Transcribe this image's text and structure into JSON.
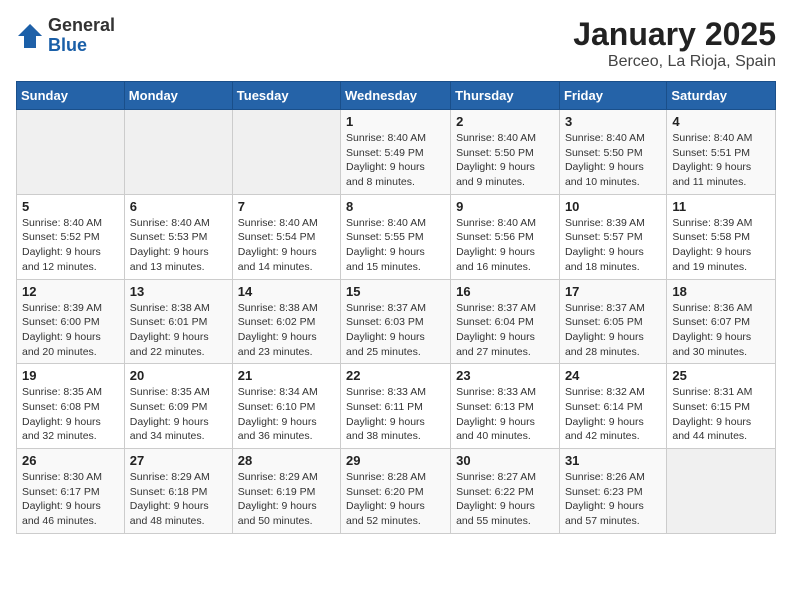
{
  "header": {
    "logo_general": "General",
    "logo_blue": "Blue",
    "month_title": "January 2025",
    "location": "Berceo, La Rioja, Spain"
  },
  "weekdays": [
    "Sunday",
    "Monday",
    "Tuesday",
    "Wednesday",
    "Thursday",
    "Friday",
    "Saturday"
  ],
  "weeks": [
    [
      {
        "day": "",
        "info": ""
      },
      {
        "day": "",
        "info": ""
      },
      {
        "day": "",
        "info": ""
      },
      {
        "day": "1",
        "info": "Sunrise: 8:40 AM\nSunset: 5:49 PM\nDaylight: 9 hours and 8 minutes."
      },
      {
        "day": "2",
        "info": "Sunrise: 8:40 AM\nSunset: 5:50 PM\nDaylight: 9 hours and 9 minutes."
      },
      {
        "day": "3",
        "info": "Sunrise: 8:40 AM\nSunset: 5:50 PM\nDaylight: 9 hours and 10 minutes."
      },
      {
        "day": "4",
        "info": "Sunrise: 8:40 AM\nSunset: 5:51 PM\nDaylight: 9 hours and 11 minutes."
      }
    ],
    [
      {
        "day": "5",
        "info": "Sunrise: 8:40 AM\nSunset: 5:52 PM\nDaylight: 9 hours and 12 minutes."
      },
      {
        "day": "6",
        "info": "Sunrise: 8:40 AM\nSunset: 5:53 PM\nDaylight: 9 hours and 13 minutes."
      },
      {
        "day": "7",
        "info": "Sunrise: 8:40 AM\nSunset: 5:54 PM\nDaylight: 9 hours and 14 minutes."
      },
      {
        "day": "8",
        "info": "Sunrise: 8:40 AM\nSunset: 5:55 PM\nDaylight: 9 hours and 15 minutes."
      },
      {
        "day": "9",
        "info": "Sunrise: 8:40 AM\nSunset: 5:56 PM\nDaylight: 9 hours and 16 minutes."
      },
      {
        "day": "10",
        "info": "Sunrise: 8:39 AM\nSunset: 5:57 PM\nDaylight: 9 hours and 18 minutes."
      },
      {
        "day": "11",
        "info": "Sunrise: 8:39 AM\nSunset: 5:58 PM\nDaylight: 9 hours and 19 minutes."
      }
    ],
    [
      {
        "day": "12",
        "info": "Sunrise: 8:39 AM\nSunset: 6:00 PM\nDaylight: 9 hours and 20 minutes."
      },
      {
        "day": "13",
        "info": "Sunrise: 8:38 AM\nSunset: 6:01 PM\nDaylight: 9 hours and 22 minutes."
      },
      {
        "day": "14",
        "info": "Sunrise: 8:38 AM\nSunset: 6:02 PM\nDaylight: 9 hours and 23 minutes."
      },
      {
        "day": "15",
        "info": "Sunrise: 8:37 AM\nSunset: 6:03 PM\nDaylight: 9 hours and 25 minutes."
      },
      {
        "day": "16",
        "info": "Sunrise: 8:37 AM\nSunset: 6:04 PM\nDaylight: 9 hours and 27 minutes."
      },
      {
        "day": "17",
        "info": "Sunrise: 8:37 AM\nSunset: 6:05 PM\nDaylight: 9 hours and 28 minutes."
      },
      {
        "day": "18",
        "info": "Sunrise: 8:36 AM\nSunset: 6:07 PM\nDaylight: 9 hours and 30 minutes."
      }
    ],
    [
      {
        "day": "19",
        "info": "Sunrise: 8:35 AM\nSunset: 6:08 PM\nDaylight: 9 hours and 32 minutes."
      },
      {
        "day": "20",
        "info": "Sunrise: 8:35 AM\nSunset: 6:09 PM\nDaylight: 9 hours and 34 minutes."
      },
      {
        "day": "21",
        "info": "Sunrise: 8:34 AM\nSunset: 6:10 PM\nDaylight: 9 hours and 36 minutes."
      },
      {
        "day": "22",
        "info": "Sunrise: 8:33 AM\nSunset: 6:11 PM\nDaylight: 9 hours and 38 minutes."
      },
      {
        "day": "23",
        "info": "Sunrise: 8:33 AM\nSunset: 6:13 PM\nDaylight: 9 hours and 40 minutes."
      },
      {
        "day": "24",
        "info": "Sunrise: 8:32 AM\nSunset: 6:14 PM\nDaylight: 9 hours and 42 minutes."
      },
      {
        "day": "25",
        "info": "Sunrise: 8:31 AM\nSunset: 6:15 PM\nDaylight: 9 hours and 44 minutes."
      }
    ],
    [
      {
        "day": "26",
        "info": "Sunrise: 8:30 AM\nSunset: 6:17 PM\nDaylight: 9 hours and 46 minutes."
      },
      {
        "day": "27",
        "info": "Sunrise: 8:29 AM\nSunset: 6:18 PM\nDaylight: 9 hours and 48 minutes."
      },
      {
        "day": "28",
        "info": "Sunrise: 8:29 AM\nSunset: 6:19 PM\nDaylight: 9 hours and 50 minutes."
      },
      {
        "day": "29",
        "info": "Sunrise: 8:28 AM\nSunset: 6:20 PM\nDaylight: 9 hours and 52 minutes."
      },
      {
        "day": "30",
        "info": "Sunrise: 8:27 AM\nSunset: 6:22 PM\nDaylight: 9 hours and 55 minutes."
      },
      {
        "day": "31",
        "info": "Sunrise: 8:26 AM\nSunset: 6:23 PM\nDaylight: 9 hours and 57 minutes."
      },
      {
        "day": "",
        "info": ""
      }
    ]
  ]
}
